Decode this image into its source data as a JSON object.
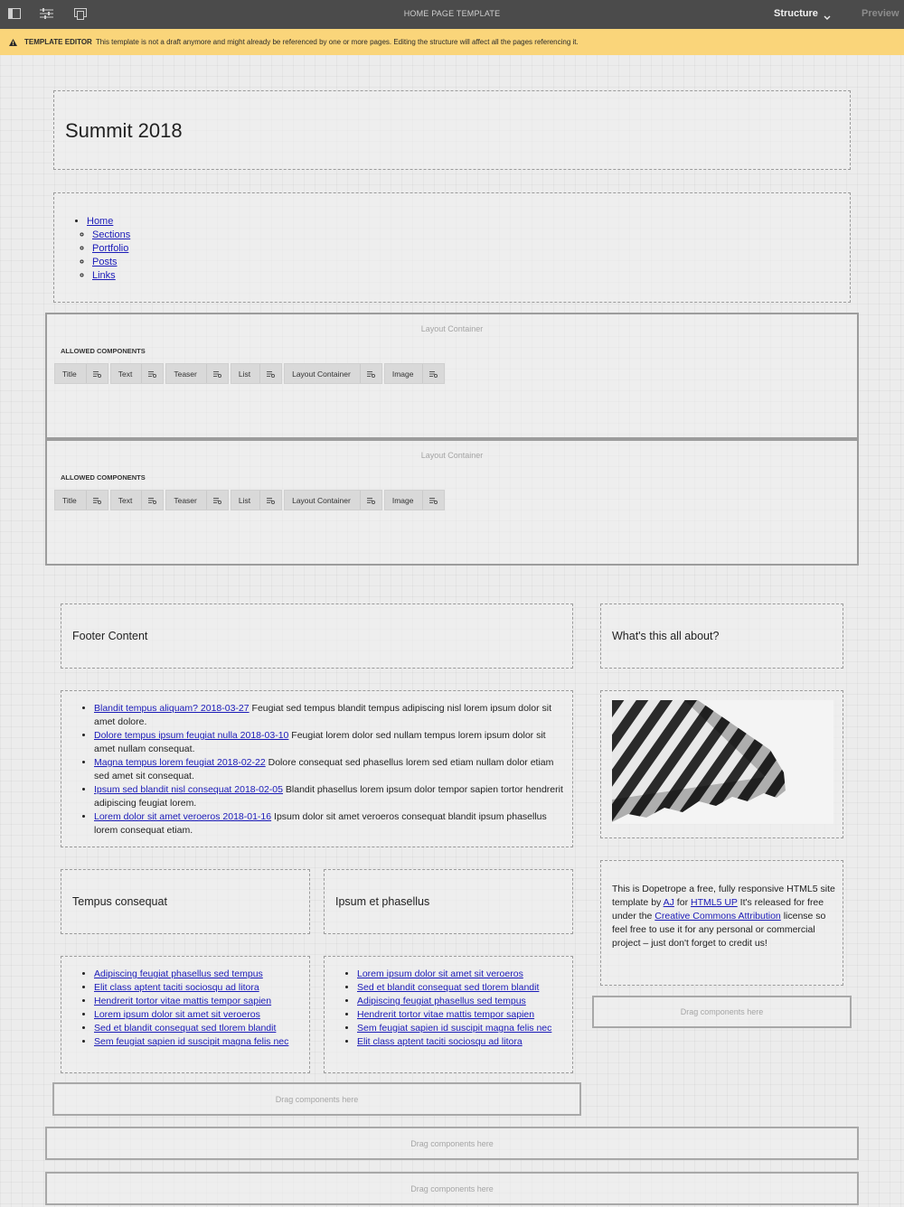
{
  "toolbar": {
    "page_title": "HOME PAGE TEMPLATE",
    "mode": "Structure",
    "preview": "Preview",
    "icons": [
      "side-panel-icon",
      "properties-icon",
      "page-layout-icon"
    ]
  },
  "banner": {
    "label": "TEMPLATE EDITOR",
    "message": "This template is not a draft anymore and might already be referenced by one or more pages. Editing the structure will affect all the pages referencing it."
  },
  "header": {
    "title": "Summit 2018"
  },
  "nav": {
    "home": "Home",
    "children": [
      "Sections",
      "Portfolio",
      "Posts",
      "Links"
    ]
  },
  "layout_containers": [
    {
      "label": "Layout Container",
      "allowed_title": "ALLOWED COMPONENTS",
      "components": [
        "Title",
        "Text",
        "Teaser",
        "List",
        "Layout Container",
        "Image"
      ]
    },
    {
      "label": "Layout Container",
      "allowed_title": "ALLOWED COMPONENTS",
      "components": [
        "Title",
        "Text",
        "Teaser",
        "List",
        "Layout Container",
        "Image"
      ]
    }
  ],
  "footer": {
    "heading": "Footer Content",
    "feed": [
      {
        "link": "Blandit tempus aliquam? 2018-03-27",
        "text": " Feugiat sed tempus blandit tempus adipiscing nisl lorem ipsum dolor sit amet dolore."
      },
      {
        "link": "Dolore tempus ipsum feugiat nulla 2018-03-10",
        "text": " Feugiat lorem dolor sed nullam tempus lorem ipsum dolor sit amet nullam consequat."
      },
      {
        "link": "Magna tempus lorem feugiat 2018-02-22",
        "text": " Dolore consequat sed phasellus lorem sed etiam nullam dolor etiam sed amet sit consequat."
      },
      {
        "link": "Ipsum sed blandit nisl consequat 2018-02-05",
        "text": " Blandit phasellus lorem ipsum dolor tempor sapien tortor hendrerit adipiscing feugiat lorem."
      },
      {
        "link": "Lorem dolor sit amet veroeros 2018-01-16",
        "text": " Ipsum dolor sit amet veroeros consequat blandit ipsum phasellus lorem consequat etiam."
      }
    ]
  },
  "col_left": {
    "heading": "Tempus consequat",
    "links": [
      "Adipiscing feugiat phasellus sed tempus",
      "Elit class aptent taciti sociosqu ad litora",
      "Hendrerit tortor vitae mattis tempor sapien",
      "Lorem ipsum dolor sit amet sit veroeros",
      "Sed et blandit consequat sed tlorem blandit",
      "Sem feugiat sapien id suscipit magna felis nec"
    ]
  },
  "col_right": {
    "heading": "Ipsum et phasellus",
    "links": [
      "Lorem ipsum dolor sit amet sit veroeros",
      "Sed et blandit consequat sed tlorem blandit",
      "Adipiscing feugiat phasellus sed tempus",
      "Hendrerit tortor vitae mattis tempor sapien",
      "Sem feugiat sapien id suscipit magna felis nec",
      "Elit class aptent taciti sociosqu ad litora"
    ]
  },
  "about": {
    "heading": "What's this all about?",
    "text_1": "This is Dopetrope a free, fully responsive HTML5 site template by ",
    "link_aj": "AJ",
    "text_2": " for ",
    "link_html5up": "HTML5 UP",
    "text_3": " It's released for free under the ",
    "link_cc": "Creative Commons Attribution",
    "text_4": " license so feel free to use it for any personal or commercial project – just don't forget to credit us!"
  },
  "drag_placeholder": "Drag components here"
}
